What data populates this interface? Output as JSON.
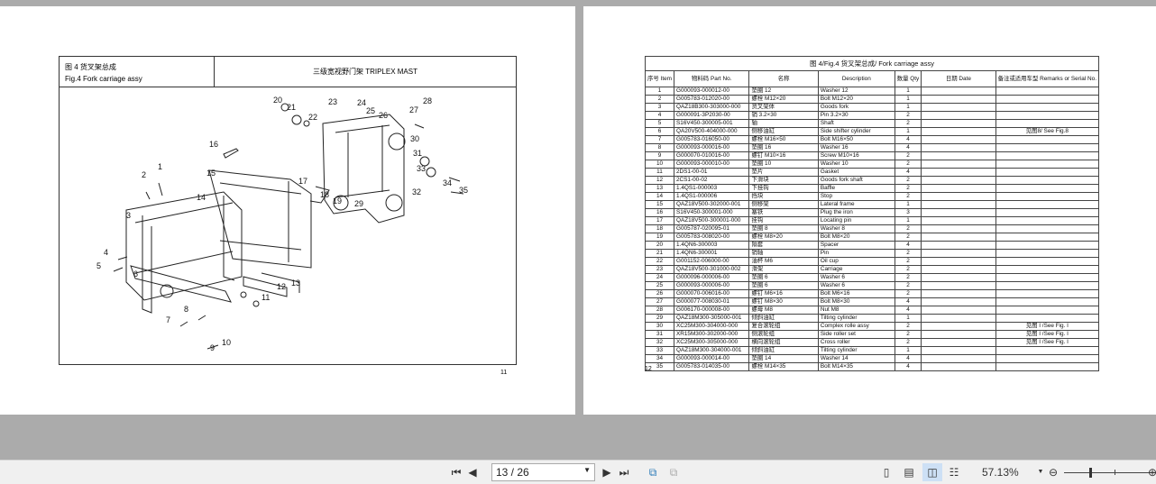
{
  "left_page": {
    "fig_cn": "图 4    货叉架总成",
    "fig_en": "Fig.4    Fork carriage assy",
    "mast_title": "三级宽视野门架 TRIPLEX MAST",
    "callouts": [
      "1",
      "2",
      "3",
      "4",
      "5",
      "6",
      "7",
      "8",
      "9",
      "10",
      "11",
      "12",
      "13",
      "14",
      "15",
      "16",
      "17",
      "18",
      "19",
      "20",
      "21",
      "22",
      "23",
      "24",
      "25",
      "26",
      "27",
      "28",
      "29",
      "30",
      "31",
      "32",
      "33",
      "34",
      "35"
    ],
    "page_number": "11"
  },
  "right_page": {
    "table_title": "图 4/Fig.4 货叉架总成/ Fork carriage assy",
    "headers": {
      "item": "序号 Item",
      "part": "物料码 Part No.",
      "cn": "名称",
      "desc": "Description",
      "qty": "数量 Qty",
      "date": "日期 Date",
      "remarks": "备注或适用车型 Remarks or Serial No."
    },
    "rows": [
      [
        "1",
        "G000093-000012-00",
        "垫圈 12",
        "Washer 12",
        "1",
        ""
      ],
      [
        "2",
        "G005783-012020-00",
        "螺栓 M12×20",
        "Bolt M12×20",
        "1",
        ""
      ],
      [
        "3",
        "QAZ18B300-303000-000",
        "货叉架体",
        "Goods fork",
        "1",
        ""
      ],
      [
        "4",
        "G000091-3P2030-00",
        "销 3.2×30",
        "Pin 3.2×30",
        "2",
        ""
      ],
      [
        "5",
        "S16V450-300005-001",
        "轴",
        "Shaft",
        "2",
        ""
      ],
      [
        "6",
        "QA20V500-404000-000",
        "侧移油缸",
        "Side shifter cylinder",
        "1",
        "见图8/ See Fig.8"
      ],
      [
        "7",
        "G005783-016050-00",
        "螺栓 M16×50",
        "Bolt M16×50",
        "4",
        ""
      ],
      [
        "8",
        "G000093-000016-00",
        "垫圈 16",
        "Washer 16",
        "4",
        ""
      ],
      [
        "9",
        "G000070-010016-00",
        "螺钉 M10×16",
        "Screw M10×16",
        "2",
        ""
      ],
      [
        "10",
        "G000093-000010-00",
        "垫圈 10",
        "Washer 10",
        "2",
        ""
      ],
      [
        "11",
        "2DS1-00-01",
        "垫片",
        "Gasket",
        "4",
        ""
      ],
      [
        "12",
        "2CS1-00-02",
        "下滑块",
        "Goods fork shaft",
        "2",
        ""
      ],
      [
        "13",
        "1.4QS1-000003",
        "下挂钩",
        "Baffle",
        "2",
        ""
      ],
      [
        "14",
        "1.4QS1-000006",
        "挡块",
        "Stop",
        "2",
        ""
      ],
      [
        "15",
        "QAZ18V500-302000-001",
        "侧移架",
        "Lateral frame",
        "1",
        ""
      ],
      [
        "16",
        "S16V450-300001-000",
        "塞铁",
        "Plug the iron",
        "3",
        ""
      ],
      [
        "17",
        "QAZ18V500-300001-000",
        "挂钩",
        "Locating pin",
        "1",
        ""
      ],
      [
        "18",
        "G005787-020095-01",
        "垫圈 8",
        "Washer 8",
        "2",
        ""
      ],
      [
        "19",
        "G005783-008020-00",
        "螺栓 M8×20",
        "Bolt M8×20",
        "2",
        ""
      ],
      [
        "20",
        "1.4QN6-300003",
        "隔套",
        "Spacer",
        "4",
        ""
      ],
      [
        "21",
        "1.4QN6-300001",
        "销轴",
        "Pin",
        "2",
        ""
      ],
      [
        "22",
        "G001152-006000-00",
        "油杯 M6",
        "Oil cup",
        "2",
        ""
      ],
      [
        "23",
        "QAZ18V500-301000-002",
        "滑架",
        "Carriage",
        "2",
        ""
      ],
      [
        "24",
        "G000096-000006-00",
        "垫圈 6",
        "Washer 6",
        "2",
        ""
      ],
      [
        "25",
        "G000093-000006-00",
        "垫圈 6",
        "Washer 6",
        "2",
        ""
      ],
      [
        "26",
        "G000070-006016-00",
        "螺钉 M6×16",
        "Bolt M6×16",
        "2",
        ""
      ],
      [
        "27",
        "G000077-008030-01",
        "螺钉 M8×30",
        "Bolt M8×30",
        "4",
        ""
      ],
      [
        "28",
        "G006170-000008-00",
        "螺母 M8",
        "Nut M8",
        "4",
        ""
      ],
      [
        "29",
        "QAZ18M300-305000-001",
        "倾斜油缸",
        "Tilting cylinder",
        "1",
        ""
      ],
      [
        "30",
        "XC25M300-304000-000",
        "复合滚轮组",
        "Complex rolle assy",
        "2",
        "见图 I /See Fig. I"
      ],
      [
        "31",
        "XR15M300-302000-000",
        "侧滚轮组",
        "Side roller set",
        "2",
        "见图 I /See Fig. I"
      ],
      [
        "32",
        "XC25M300-305000-000",
        "横向滚轮组",
        "Cross roller",
        "2",
        "见图 I /See Fig. I"
      ],
      [
        "33",
        "QAZ18M300-304000-001",
        "倾斜油缸",
        "Tilting cylinder",
        "1",
        ""
      ],
      [
        "34",
        "G000093-000014-00",
        "垫圈 14",
        "Washer 14",
        "4",
        ""
      ],
      [
        "35",
        "G005783-014035-00",
        "螺栓 M14×35",
        "Bolt M14×35",
        "4",
        ""
      ]
    ],
    "page_number": "12"
  },
  "toolbar": {
    "page_value": "13 / 26",
    "zoom": "57.13%"
  }
}
